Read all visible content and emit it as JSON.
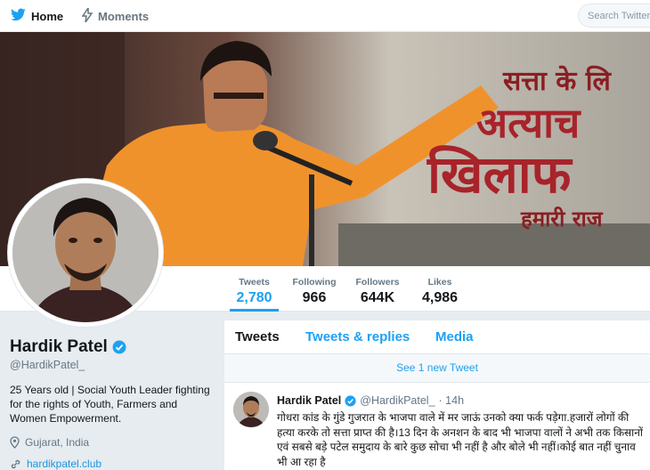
{
  "nav": {
    "home_label": "Home",
    "moments_label": "Moments",
    "search_placeholder": "Search Twitter"
  },
  "banner": {
    "line1": "सत्ता के लि",
    "line2": "अत्याच",
    "line3": "खिलाफ",
    "line4": "हमारी राज"
  },
  "stats": [
    {
      "label": "Tweets",
      "value": "2,780"
    },
    {
      "label": "Following",
      "value": "966"
    },
    {
      "label": "Followers",
      "value": "644K"
    },
    {
      "label": "Likes",
      "value": "4,986"
    }
  ],
  "profile": {
    "name": "Hardik Patel",
    "handle": "@HardikPatel_",
    "bio": "25 Years old | Social Youth Leader fighting for the rights of Youth, Farmers and Women Empowerment.",
    "location": "Gujarat, India",
    "url": "hardikpatel.club"
  },
  "timeline": {
    "tabs": [
      "Tweets",
      "Tweets & replies",
      "Media"
    ],
    "new_tweets": "See 1 new Tweet"
  },
  "tweet": {
    "name": "Hardik Patel",
    "handle": "@HardikPatel_",
    "time": "· 14h",
    "text": "गोधरा कांड के गुंडे गुजरात के भाजपा वाले में मर जाऊं उनको क्या फर्क पड़ेगा.हजारों लोगों की हत्या करके तो सत्ता प्राप्त की है।13 दिन के अनशन के बाद भी भाजपा वालों ने अभी तक किसानों एवं सबसे बड़े पटेल समुदाय के बारे कुछ सोचा भी नहीं है और बोले भी नहीं।कोई बात नहीं चुनाव भी आ रहा है"
  },
  "colors": {
    "accent": "#1da1f2",
    "banner_red": "#a8232a",
    "kurta_orange": "#f0922c"
  }
}
